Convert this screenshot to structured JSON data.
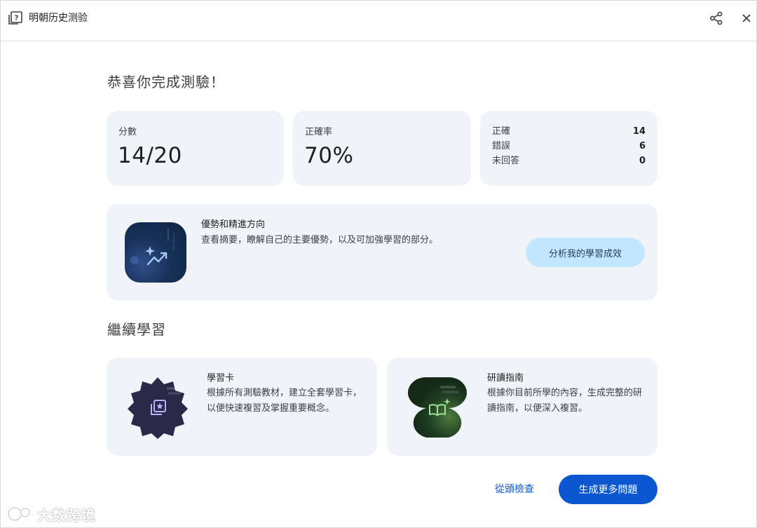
{
  "window": {
    "title": "明朝历史测验"
  },
  "summary": {
    "heading": "恭喜你完成測驗！",
    "score": {
      "label": "分數",
      "value": "14/20"
    },
    "accuracy": {
      "label": "正確率",
      "value": "70%"
    },
    "breakdown": [
      {
        "label": "正確",
        "value": "14"
      },
      {
        "label": "錯誤",
        "value": "6"
      },
      {
        "label": "未回答",
        "value": "0"
      }
    ]
  },
  "insight": {
    "title": "優勢和精進方向",
    "description": "查看摘要，瞭解自己的主要優勢，以及可加強學習的部分。",
    "button_label": "分析我的學習成效"
  },
  "continue_learning": {
    "heading": "繼續學習",
    "cards": [
      {
        "title": "學習卡",
        "description": "根據所有測驗教材，建立全套學習卡，以便快速複習及掌握重要概念。"
      },
      {
        "title": "研讀指南",
        "description": "根據你目前所學的內容，生成完整的研讀指南，以便深入複習。"
      }
    ]
  },
  "actions": {
    "restart_label": "從頭檢查",
    "generate_label": "生成更多問題"
  },
  "watermark": {
    "text": "大数跨境"
  },
  "colors": {
    "accent": "#0b57d0",
    "card_bg": "#f0f4f9",
    "chip_bg": "#c2e7ff"
  }
}
